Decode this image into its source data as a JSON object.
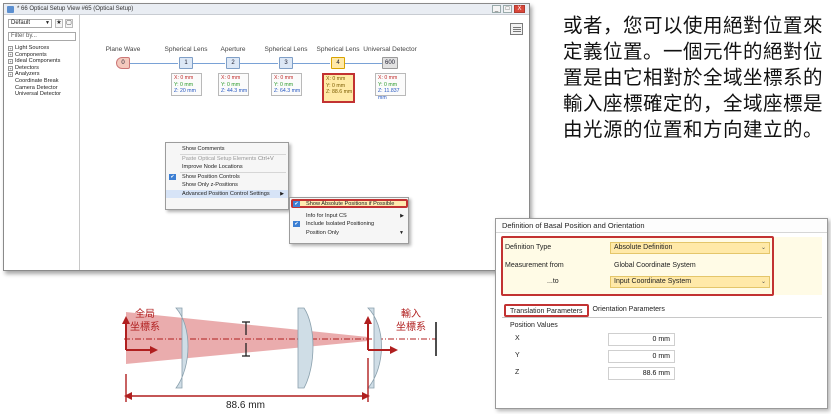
{
  "window": {
    "title": "* 66 Optical Setup View #65 (Optical Setup)",
    "controls": [
      "_",
      "□",
      "X"
    ]
  },
  "left_panel": {
    "preset": "Default",
    "filter_placeholder": "Filter by...",
    "tree": [
      {
        "label": "Light Sources",
        "expandable": true
      },
      {
        "label": "Components",
        "expandable": true
      },
      {
        "label": "Ideal Components",
        "expandable": true
      },
      {
        "label": "Detectors",
        "expandable": true
      },
      {
        "label": "Analyzers",
        "expandable": true
      },
      {
        "label": "Coordinate Break",
        "expandable": false
      },
      {
        "label": "Camera Detector",
        "expandable": false
      },
      {
        "label": "Universal Detector",
        "expandable": false
      }
    ]
  },
  "nodes": [
    {
      "label": "Plane Wave",
      "index": "0",
      "pos": null
    },
    {
      "label": "Spherical Lens",
      "index": "1",
      "pos": {
        "x": "X: 0 mm",
        "y": "Y: 0 mm",
        "z": "Z: 20 mm"
      }
    },
    {
      "label": "Aperture",
      "index": "2",
      "pos": {
        "x": "X: 0 mm",
        "y": "Y: 0 mm",
        "z": "Z: 44.3 mm"
      }
    },
    {
      "label": "Spherical Lens",
      "index": "3",
      "pos": {
        "x": "X: 0 mm",
        "y": "Y: 0 mm",
        "z": "Z: 64.3 mm"
      }
    },
    {
      "label": "Spherical Lens",
      "index": "4",
      "pos": {
        "x": "X: 0 mm",
        "y": "Y: 0 mm",
        "z": "Z: 88.6 mm"
      }
    },
    {
      "label": "Universal Detector",
      "index": "600",
      "pos": {
        "x": "X: 0 mm",
        "y": "Y: 0 mm",
        "z": "Z: 11.837 mm"
      }
    }
  ],
  "context_menu": {
    "items": [
      {
        "label": "Show Comments",
        "disabled": false
      },
      {
        "label": "Paste Optical Setup Elements",
        "shortcut": "Ctrl+V",
        "disabled": true
      },
      {
        "label": "Improve Node Locations",
        "disabled": false
      },
      {
        "label": "Show Position Controls",
        "checked": true
      },
      {
        "label": "Show Only z-Positions",
        "disabled": false
      },
      {
        "label": "Advanced Position Control Settings",
        "submenu": true
      }
    ],
    "submenu": [
      {
        "label": "Show Absolute Positions if Possible",
        "checked": true
      },
      {
        "label": "Info for Input CS",
        "submenu": true
      },
      {
        "label": "Include Isolated Positioning",
        "checked": true
      },
      {
        "label": "Position Only",
        "submenu": true
      }
    ]
  },
  "annotation": "或者，您可以使用絕對位置來定義位置。一個元件的絕對位置是由它相對於全域坐標系的輸入座標確定的，全域座標是由光源的位置和方向建立的。",
  "dialog": {
    "title": "Definition of Basal Position and Orientation",
    "definition_type_label": "Definition Type",
    "definition_type_value": "Absolute Definition",
    "measurement_from_label": "Measurement from",
    "measurement_from_value": "Global Coordinate System",
    "to_label": "...to",
    "to_value": "Input Coordinate System",
    "tab_translation": "Translation Parameters",
    "tab_orientation": "Orientation Parameters",
    "position_values_label": "Position Values",
    "x_label": "X",
    "x_value": "0 mm",
    "y_label": "Y",
    "y_value": "0 mm",
    "z_label": "Z",
    "z_value": "88.6 mm"
  },
  "diagram": {
    "global_cs_label": "全局\n坐標系",
    "input_cs_label": "輸入\n坐標系",
    "distance": "88.6 mm"
  },
  "colors": {
    "highlight_red": "#c23232",
    "highlight_fill": "#ffe9a8",
    "beam": "#d9686a",
    "lens": "#cfdde6"
  }
}
